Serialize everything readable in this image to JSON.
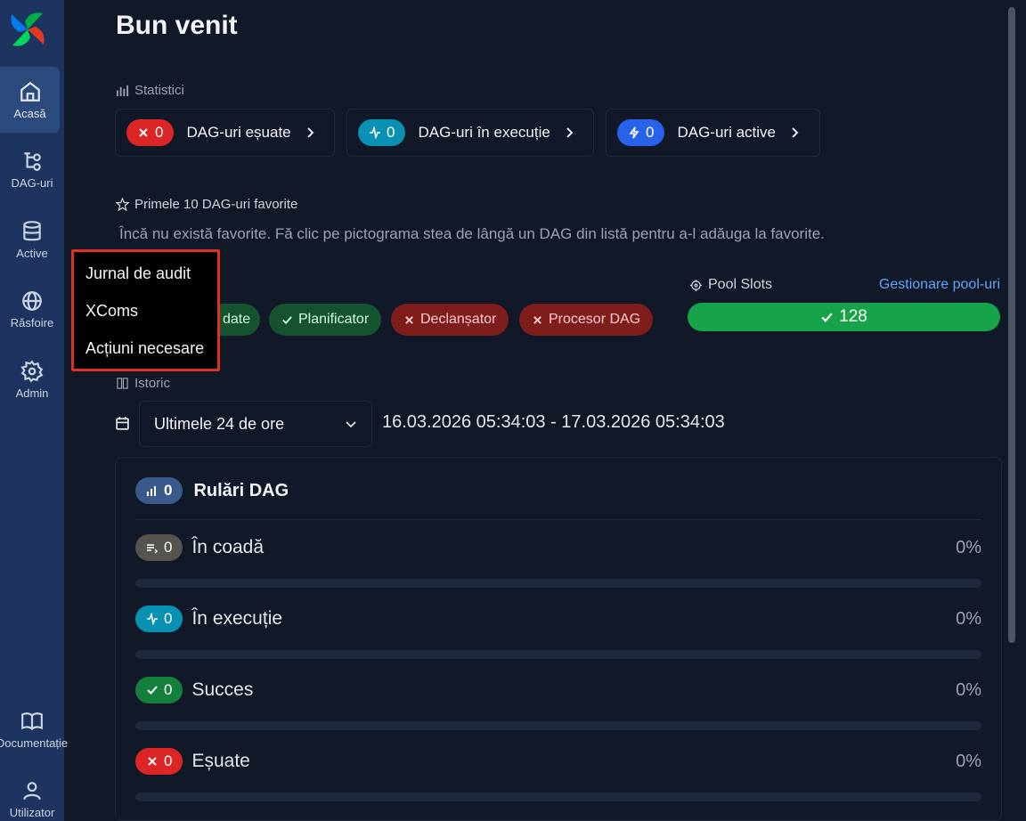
{
  "sidebar": {
    "items": [
      {
        "label": "Acasă",
        "icon": "home-icon"
      },
      {
        "label": "DAG-uri",
        "icon": "dag-icon"
      },
      {
        "label": "Active",
        "icon": "database-icon"
      },
      {
        "label": "Răsfoire",
        "icon": "globe-icon"
      },
      {
        "label": "Admin",
        "icon": "gear-icon"
      }
    ],
    "bottom": [
      {
        "label": "Documentație",
        "icon": "book-icon"
      },
      {
        "label": "Utilizator",
        "icon": "user-icon"
      }
    ]
  },
  "header": {
    "title": "Bun venit"
  },
  "stats": {
    "label": "Statistici",
    "cards": [
      {
        "count": "0",
        "label": "DAG-uri eșuate",
        "color": "#dc2626"
      },
      {
        "count": "0",
        "label": "DAG-uri în execuție",
        "color": "#0891b2"
      },
      {
        "count": "0",
        "label": "DAG-uri active",
        "color": "#2563eb"
      }
    ]
  },
  "favorites": {
    "label": "Primele 10 DAG-uri favorite",
    "empty_text": "Încă nu există favorite. Fă clic pe pictograma stea de lângă un DAG din listă pentru a-l adăuga la favorite."
  },
  "health": {
    "items": [
      {
        "label": "date",
        "status": "ok"
      },
      {
        "label": "Planificator",
        "status": "ok"
      },
      {
        "label": "Declanșator",
        "status": "bad"
      },
      {
        "label": "Procesor DAG",
        "status": "bad"
      }
    ]
  },
  "pool": {
    "label": "Pool Slots",
    "manage": "Gestionare pool-uri",
    "value": "128",
    "color": "#16a34a"
  },
  "history": {
    "label": "Istoric",
    "range_select": "Ultimele 24 de ore",
    "date_range": "16.03.2026 05:34:03 - 17.03.2026 05:34:03"
  },
  "runs": {
    "title": "Rulări DAG",
    "count": "0",
    "rows": [
      {
        "label": "În coadă",
        "count": "0",
        "pct": "0%",
        "color": "#57534e"
      },
      {
        "label": "În execuție",
        "count": "0",
        "pct": "0%",
        "color": "#0891b2"
      },
      {
        "label": "Succes",
        "count": "0",
        "pct": "0%",
        "color": "#15803d"
      },
      {
        "label": "Eșuate",
        "count": "0",
        "pct": "0%",
        "color": "#dc2626"
      }
    ]
  },
  "menu": {
    "items": [
      "Jurnal de audit",
      "XComs",
      "Acțiuni necesare"
    ]
  }
}
